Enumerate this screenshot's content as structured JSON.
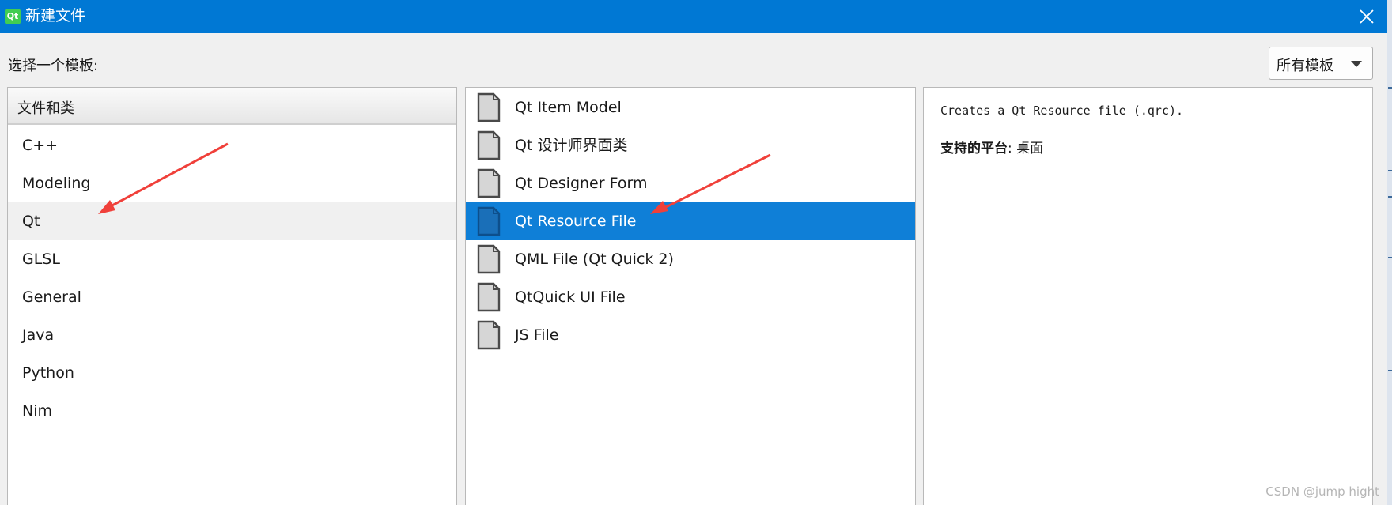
{
  "window": {
    "title": "新建文件",
    "app_icon_text": "Qt"
  },
  "header": {
    "choose_label": "选择一个模板:",
    "filter_selected": "所有模板"
  },
  "categories": {
    "header": "文件和类",
    "items": [
      {
        "label": "C++"
      },
      {
        "label": "Modeling"
      },
      {
        "label": "Qt",
        "selected": true
      },
      {
        "label": "GLSL"
      },
      {
        "label": "General"
      },
      {
        "label": "Java"
      },
      {
        "label": "Python"
      },
      {
        "label": "Nim"
      }
    ]
  },
  "templates": {
    "items": [
      {
        "label": "Qt Item Model"
      },
      {
        "label": "Qt 设计师界面类"
      },
      {
        "label": "Qt Designer Form"
      },
      {
        "label": "Qt Resource File",
        "selected": true
      },
      {
        "label": "QML File (Qt Quick 2)"
      },
      {
        "label": "QtQuick UI File"
      },
      {
        "label": "JS File"
      }
    ]
  },
  "details": {
    "description": "Creates a Qt Resource file (.qrc).",
    "platform_label": "支持的平台",
    "platform_sep": ": ",
    "platform_value": "桌面"
  },
  "watermark": "CSDN @jump hight",
  "colors": {
    "titlebar": "#0078d4",
    "selection": "#0f7fd7",
    "arrow": "#f0403a"
  }
}
